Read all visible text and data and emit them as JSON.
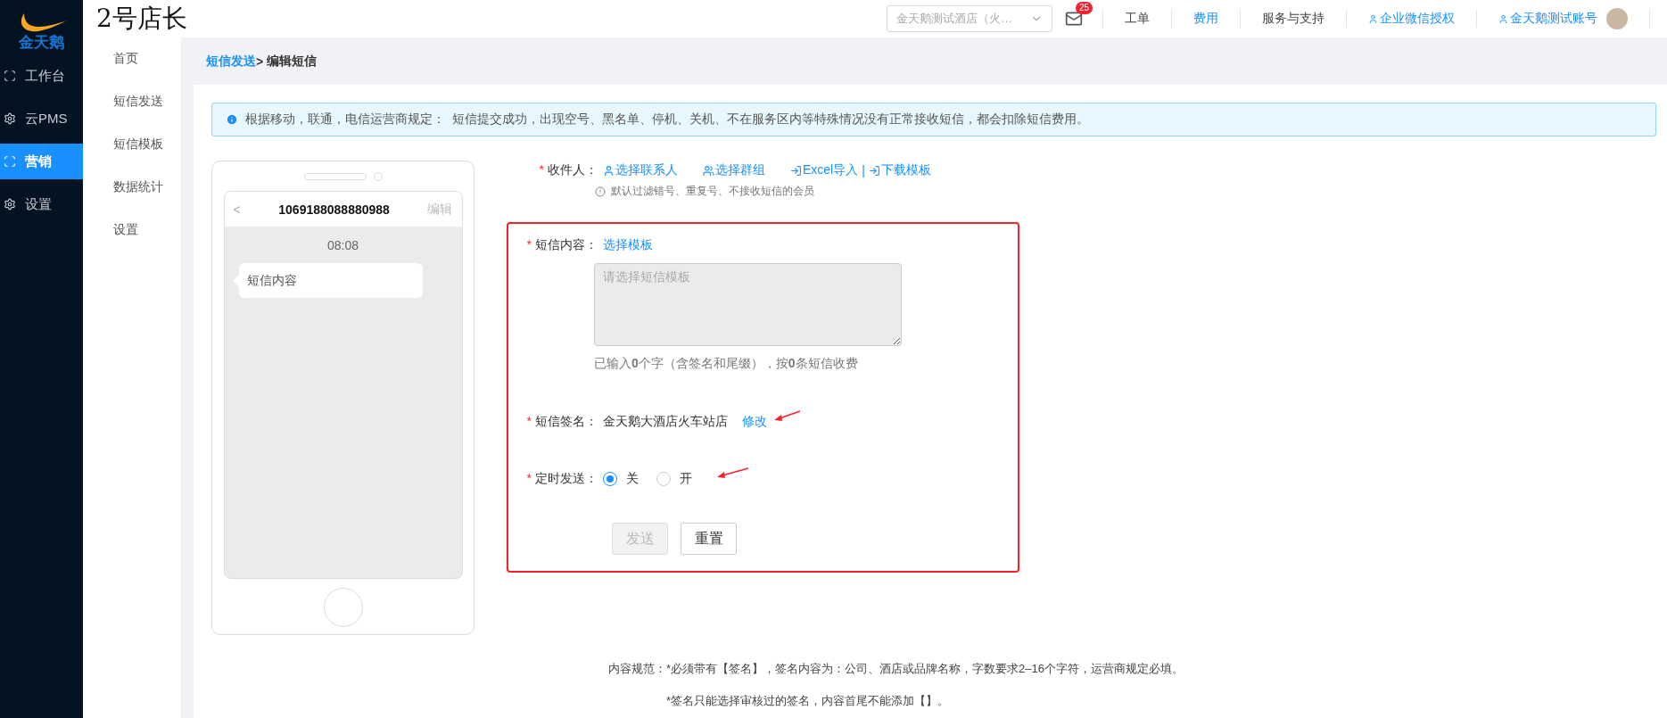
{
  "brand": {
    "logo_text": "金天鹅",
    "app_title": "2号店长"
  },
  "nav": [
    {
      "label": "工作台",
      "kind": "scan",
      "selected": false
    },
    {
      "label": "云PMS",
      "kind": "gear",
      "selected": false
    },
    {
      "label": "营销",
      "kind": "scan",
      "selected": true
    },
    {
      "label": "设置",
      "kind": "gear",
      "selected": false
    }
  ],
  "subnav": [
    "首页",
    "短信发送",
    "短信模板",
    "数据统计",
    "设置"
  ],
  "header": {
    "store_select": {
      "value": "金天鹅测试酒店（火…"
    },
    "mail_badge": "25",
    "links": [
      {
        "label": "工单",
        "kind": "text",
        "selected": false
      },
      {
        "label": "费用",
        "kind": "text",
        "selected": true
      },
      {
        "label": "服务与支持",
        "kind": "text",
        "selected": false
      },
      {
        "label": "企业微信授权",
        "kind": "user"
      },
      {
        "label": "金天鹅测试账号",
        "kind": "account"
      }
    ]
  },
  "breadcrumb": {
    "parent": "短信发送",
    "separator": ">",
    "current": "编辑短信"
  },
  "alert": "根据移动，联通，电信运营商规定：  短信提交成功，出现空号、黑名单、停机、关机、不在服务区内等特殊情况没有正常接收短信，都会扣除短信费用。",
  "phone": {
    "back": "<",
    "number": "1069188088880988",
    "edit": "编辑",
    "time": "08:08",
    "message": "短信内容"
  },
  "form": {
    "recipients": {
      "marker": "*",
      "label": "收件人：",
      "actions": [
        {
          "label": "选择联系人",
          "kind": "user"
        },
        {
          "label": "选择群组",
          "kind": "users"
        },
        {
          "label": "Excel导入",
          "kind": "import"
        },
        {
          "separator": "|",
          "label": "下载模板",
          "kind": "import"
        }
      ],
      "hint": "默认过滤错号、重复号、不接收短信的会员"
    },
    "content": {
      "marker": "*",
      "label": "短信内容：",
      "link": "选择模板",
      "placeholder": "请选择短信模板",
      "counter": "已输入**0**个字（含签名和尾缀），按**0**条短信收费"
    },
    "signature": {
      "marker": "*",
      "label": "短信签名：",
      "value": "金天鹅大酒店火车站店",
      "link": "修改"
    },
    "schedule": {
      "marker": "*",
      "label": "定时发送：",
      "options": [
        {
          "label": "关",
          "selected": true
        },
        {
          "label": "开",
          "selected": false
        }
      ]
    },
    "buttons": [
      {
        "label": "发送",
        "disabled": true
      },
      {
        "label": "重置",
        "disabled": false
      }
    ]
  },
  "notes": {
    "label": "内容规范：",
    "lines": [
      "*必须带有【签名】，签名内容为：公司、酒店或品牌名称，字数要求2–16个字符，运营商规定必填。",
      "*签名只能选择审核过的签名，内容首尾不能添加【】。"
    ]
  }
}
